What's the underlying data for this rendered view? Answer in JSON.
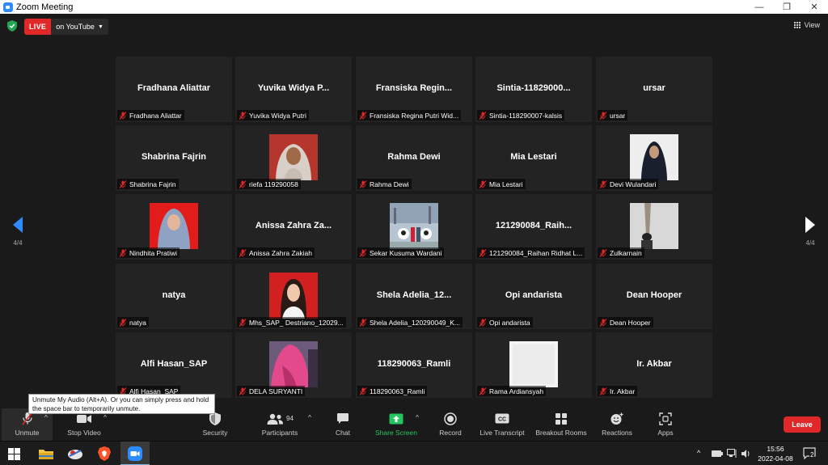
{
  "window": {
    "title": "Zoom Meeting",
    "controls": [
      "—",
      "❐",
      "✕"
    ]
  },
  "topbar": {
    "live_label": "LIVE",
    "live_destination": "on YouTube",
    "view_label": "View"
  },
  "pagination": {
    "left_page": "4/4",
    "right_page": "4/4"
  },
  "participants": [
    {
      "display_name": "Fradhana Aliattar",
      "label": "Fradhana Aliattar",
      "video": false
    },
    {
      "display_name": "Yuvika  Widya  P...",
      "label": "Yuvika Widya Putri",
      "video": false
    },
    {
      "display_name": "Fransiska  Regin...",
      "label": "Fransiska Regina Putri Wid...",
      "video": false
    },
    {
      "display_name": "Sintia-11829000...",
      "label": "Sintia-118290007-kalsis",
      "video": false
    },
    {
      "display_name": "ursar",
      "label": "ursar",
      "video": false
    },
    {
      "display_name": "Shabrina Fajrin",
      "label": "Shabrina Fajrin",
      "video": false
    },
    {
      "display_name": "",
      "label": "riefa 119290058",
      "video": true,
      "photo": "hijab-brown"
    },
    {
      "display_name": "Rahma Dewi",
      "label": "Rahma Dewi",
      "video": false
    },
    {
      "display_name": "Mia Lestari",
      "label": "Mia Lestari",
      "video": false
    },
    {
      "display_name": "",
      "label": "Devi Wulandari",
      "video": true,
      "photo": "hijab-black"
    },
    {
      "display_name": "",
      "label": "Nindhita Pratiwi",
      "video": true,
      "photo": "hijab-red-bg"
    },
    {
      "display_name": "Anissa Zahra Za...",
      "label": "Anissa Zahra Zakiah",
      "video": false
    },
    {
      "display_name": "",
      "label": "Sekar Kusuma Wardani",
      "video": true,
      "photo": "group-outdoor"
    },
    {
      "display_name": "121290084_Raih...",
      "label": "121290084_Raihan Ridhat L...",
      "video": false
    },
    {
      "display_name": "",
      "label": "Zulkarnain",
      "video": true,
      "photo": "person-sky"
    },
    {
      "display_name": "natya",
      "label": "natya",
      "video": false
    },
    {
      "display_name": "",
      "label": "Mhs_SAP_ Destriano_12029...",
      "video": true,
      "photo": "girl-red-bg"
    },
    {
      "display_name": "Shela  Adelia_12...",
      "label": "Shela Adelia_120290049_K...",
      "video": false
    },
    {
      "display_name": "Opi andarista",
      "label": "Opi andarista",
      "video": false
    },
    {
      "display_name": "Dean Hooper",
      "label": "Dean Hooper",
      "video": false
    },
    {
      "display_name": "Alfi Hasan_SAP",
      "label": "Alfi Hasan_SAP",
      "video": false
    },
    {
      "display_name": "",
      "label": "DELA SURYANTI",
      "video": true,
      "photo": "pink-hijab"
    },
    {
      "display_name": "118290063_Ramli",
      "label": "118290063_Ramli",
      "video": false
    },
    {
      "display_name": "",
      "label": "Rama Ardiansyah",
      "video": true,
      "photo": "white-blank"
    },
    {
      "display_name": "Ir. Akbar",
      "label": "Ir. Akbar",
      "video": false
    }
  ],
  "tooltip": {
    "text": "Unmute My Audio (Alt+A). Or you can simply press and hold the space bar to temporarily unmute."
  },
  "toolbar": {
    "unmute": "Unmute",
    "stop_video": "Stop Video",
    "security": "Security",
    "participants": "Participants",
    "participants_count": "94",
    "chat": "Chat",
    "share_screen": "Share Screen",
    "record": "Record",
    "live_transcript": "Live Transcript",
    "breakout_rooms": "Breakout Rooms",
    "reactions": "Reactions",
    "apps": "Apps",
    "leave": "Leave",
    "share_color": "#22c55e",
    "leave_color": "#e02828"
  },
  "taskbar": {
    "time": "15:56",
    "date": "2022-04-08",
    "notification_count": "2",
    "apps": [
      "start-icon",
      "file-explorer-icon",
      "browser-icon",
      "brave-icon",
      "zoom-icon"
    ]
  }
}
